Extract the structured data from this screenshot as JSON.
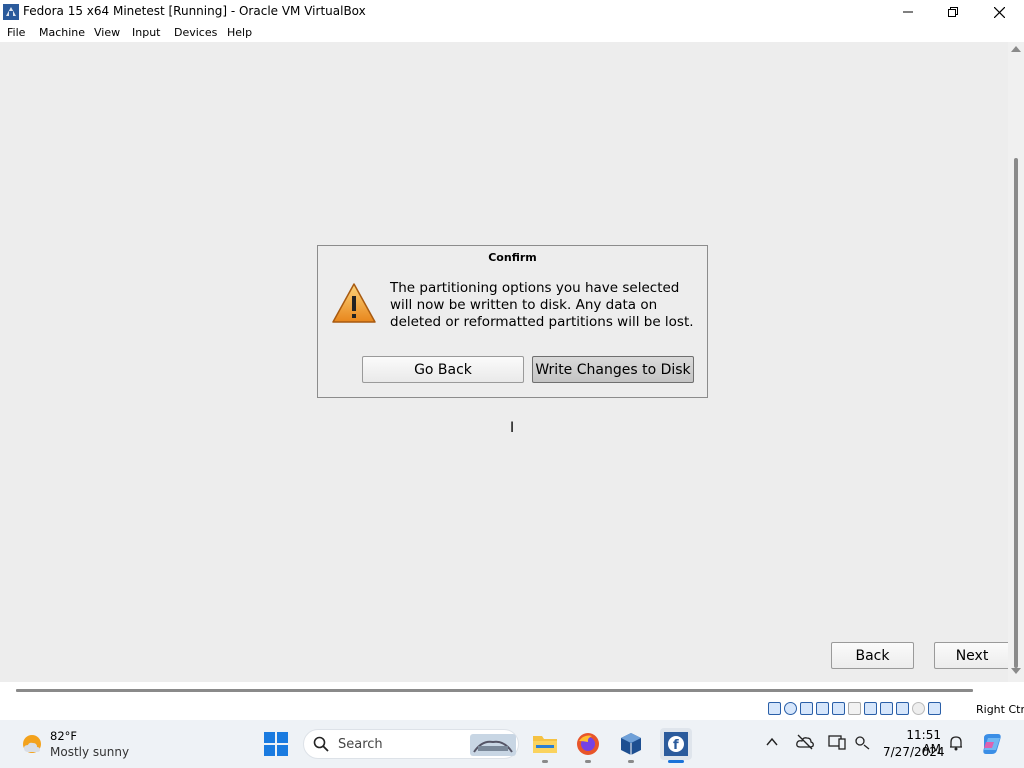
{
  "window": {
    "title": "Fedora 15 x64 Minetest [Running] - Oracle VM VirtualBox"
  },
  "menu": [
    "File",
    "Machine",
    "View",
    "Input",
    "Devices",
    "Help"
  ],
  "dialog": {
    "title": "Confirm",
    "message": "The partitioning options you have selected will now be written to disk.  Any data on deleted or reformatted partitions will be lost.",
    "go_back_label": "Go Back",
    "write_label": "Write Changes to Disk"
  },
  "installer_nav": {
    "back_label": "Back",
    "next_label": "Next"
  },
  "statusbar": {
    "host_key": "Right Ctrl"
  },
  "taskbar": {
    "weather_temp": "82°F",
    "weather_desc": "Mostly sunny",
    "search_placeholder": "Search",
    "clock_time": "11:51 AM",
    "clock_date": "7/27/2024"
  },
  "colors": {
    "accent_blue": "#1a73d9",
    "warning_orange": "#f0a030"
  }
}
